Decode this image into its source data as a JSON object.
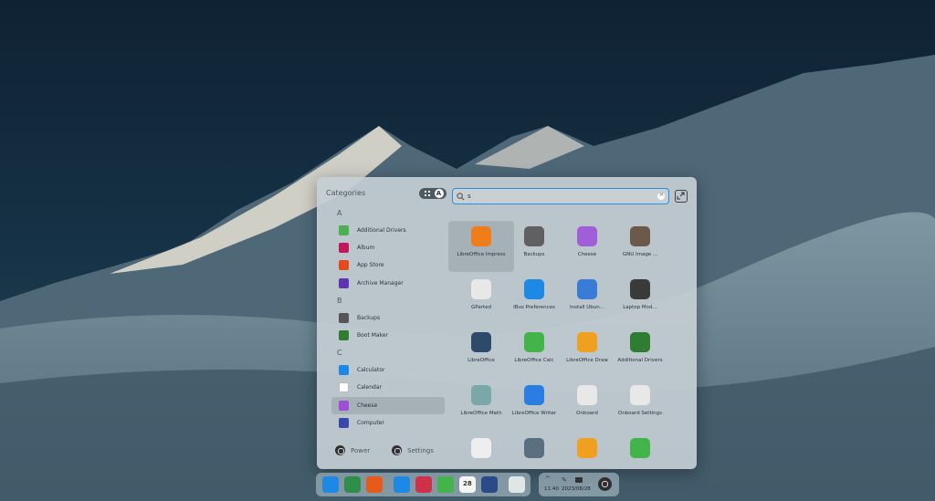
{
  "launcher": {
    "categories_title": "Categories",
    "mode_alpha_glyph": "A",
    "search": {
      "value": "s"
    },
    "sections": [
      {
        "letter": "A",
        "items": [
          {
            "label": "Additional Drivers",
            "icon": "drivers-icon",
            "color": "#4caf50"
          },
          {
            "label": "Album",
            "icon": "album-icon",
            "color": "#c2185b"
          },
          {
            "label": "App Store",
            "icon": "app-store-icon",
            "color": "#e64a19"
          },
          {
            "label": "Archive Manager",
            "icon": "archive-icon",
            "color": "#5e35b1"
          }
        ]
      },
      {
        "letter": "B",
        "items": [
          {
            "label": "Backups",
            "icon": "backups-icon",
            "color": "#555555"
          },
          {
            "label": "Boot Maker",
            "icon": "boot-maker-icon",
            "color": "#2e7d32"
          }
        ]
      },
      {
        "letter": "C",
        "items": [
          {
            "label": "Calculator",
            "icon": "calculator-icon",
            "color": "#1e88e5"
          },
          {
            "label": "Calendar",
            "icon": "calendar-icon",
            "color": "#ffffff"
          },
          {
            "label": "Cheese",
            "icon": "cheese-icon",
            "color": "#9c4fd6"
          },
          {
            "label": "Computer",
            "icon": "computer-icon",
            "color": "#3949ab"
          }
        ]
      }
    ],
    "footer": {
      "power": "Power",
      "settings": "Settings"
    },
    "apps": [
      {
        "name": "LibreOffice Impress",
        "icon": "libreoffice-impress-icon",
        "color": "#ef7d1a",
        "selected": true
      },
      {
        "name": "Backups",
        "icon": "backups-icon",
        "color": "#606060"
      },
      {
        "name": "Cheese",
        "icon": "cheese-icon",
        "color": "#a05ed8"
      },
      {
        "name": "GNU Image ...",
        "icon": "gimp-icon",
        "color": "#6b5a4a"
      },
      {
        "name": "GParted",
        "icon": "gparted-icon",
        "color": "#e8e8e8"
      },
      {
        "name": "IBus Preferences",
        "icon": "ibus-icon",
        "color": "#1e88e5"
      },
      {
        "name": "Install Ubun...",
        "icon": "install-ubuntu-icon",
        "color": "#3a7bd5"
      },
      {
        "name": "Laptop Mod...",
        "icon": "laptop-mode-icon",
        "color": "#3a3a3a"
      },
      {
        "name": "LibreOffice",
        "icon": "libreoffice-icon",
        "color": "#2d4a6b"
      },
      {
        "name": "LibreOffice Calc",
        "icon": "libreoffice-calc-icon",
        "color": "#43b449"
      },
      {
        "name": "LibreOffice Draw",
        "icon": "libreoffice-draw-icon",
        "color": "#f0a020"
      },
      {
        "name": "Additional Drivers",
        "icon": "drivers-icon",
        "color": "#2f7d32"
      },
      {
        "name": "LibreOffice Math",
        "icon": "libreoffice-math-icon",
        "color": "#7aa8a8"
      },
      {
        "name": "LibreOffice Writer",
        "icon": "libreoffice-writer-icon",
        "color": "#2a7de1"
      },
      {
        "name": "Onboard",
        "icon": "keyboard-icon",
        "color": "#e8e8e8"
      },
      {
        "name": "Onboard Settings",
        "icon": "keyboard-settings-icon",
        "color": "#e8e8e8"
      },
      {
        "name": "",
        "icon": "printer-icon",
        "color": "#eeeeee"
      },
      {
        "name": "",
        "icon": "download-icon",
        "color": "#5a7080"
      },
      {
        "name": "",
        "icon": "update-icon",
        "color": "#f0a020"
      },
      {
        "name": "",
        "icon": "rocket-icon",
        "color": "#43b449"
      }
    ]
  },
  "dock": {
    "apps": [
      {
        "icon": "launcher-icon",
        "color": "#1e88e5"
      },
      {
        "icon": "files-icon",
        "color": "#2f8f4a"
      },
      {
        "icon": "app-store-icon",
        "color": "#e65a1a"
      },
      {
        "icon": "calculator-icon",
        "color": "#1e88e5"
      },
      {
        "icon": "album-icon",
        "color": "#d0304a"
      },
      {
        "icon": "music-icon",
        "color": "#43b449"
      },
      {
        "icon": "calendar-icon",
        "color": "#f5f5f5",
        "text": "28"
      },
      {
        "icon": "settings-icon",
        "color": "#2a4a8a"
      },
      {
        "icon": "trash-icon",
        "color": "#dfe6e6"
      }
    ]
  },
  "tray": {
    "time": "11:40",
    "date": "2023/08/28"
  }
}
